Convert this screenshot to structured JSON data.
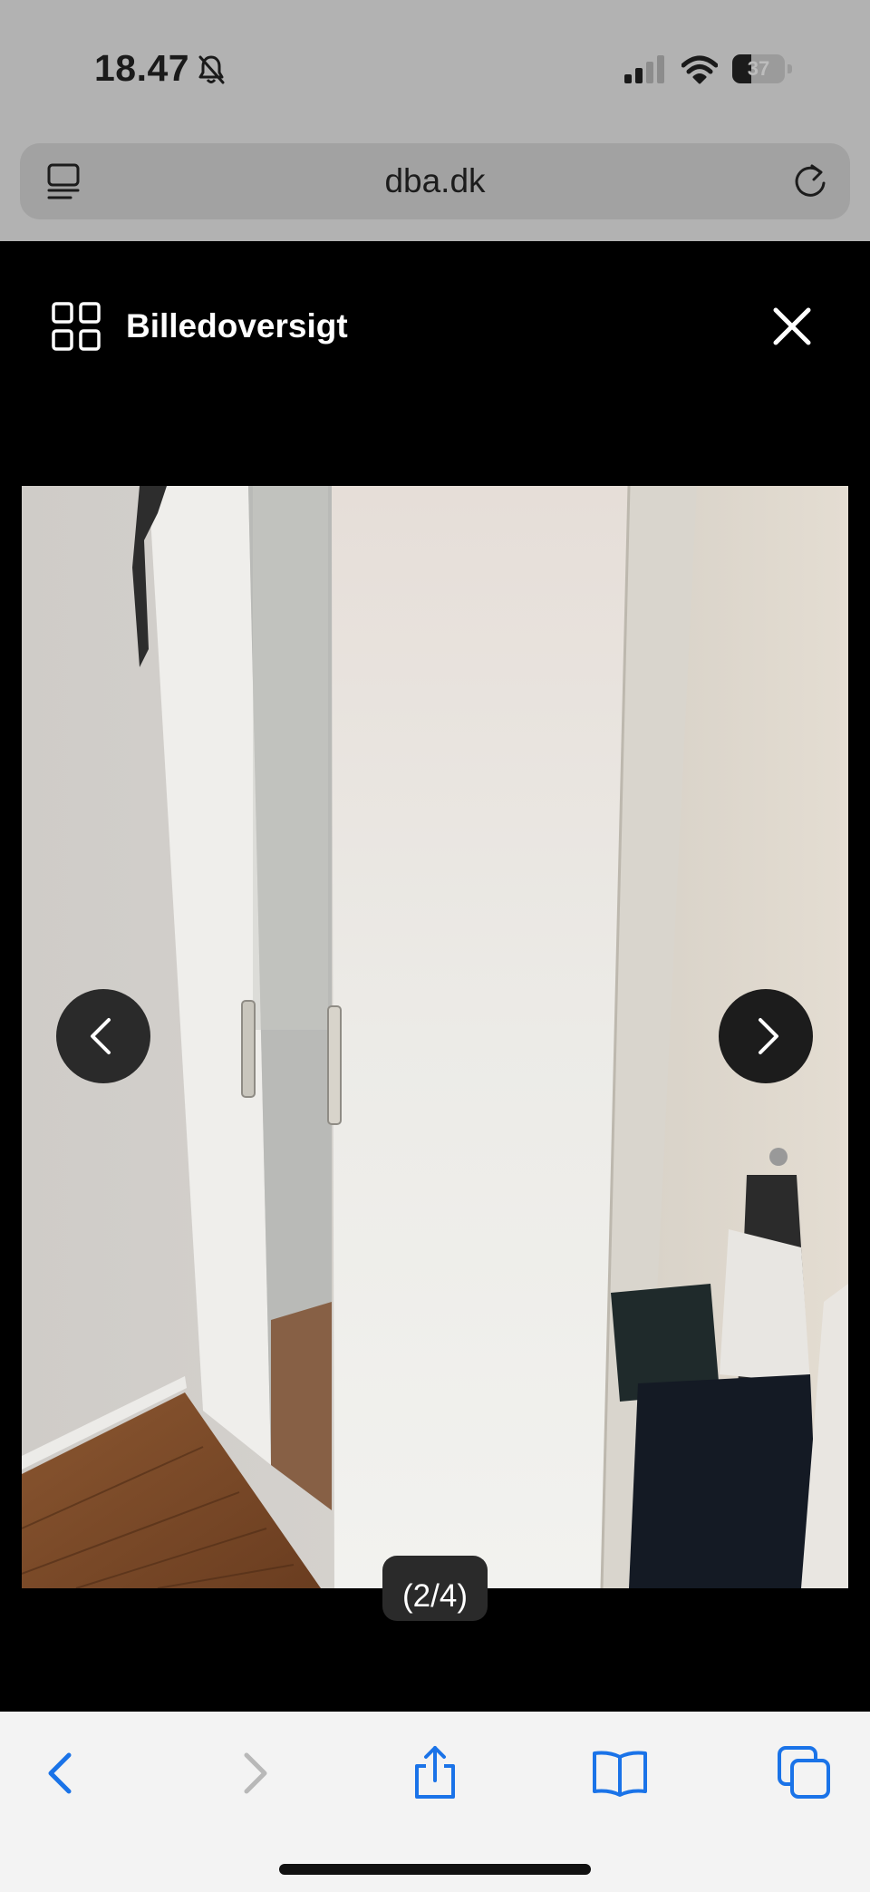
{
  "status_bar": {
    "time": "18.47",
    "battery_percent": "37",
    "battery_level": 0.37,
    "icons": [
      "bell-slash-icon",
      "cellular-signal-icon",
      "wifi-icon",
      "battery-icon"
    ]
  },
  "browser": {
    "url": "dba.dk",
    "icons": [
      "reader-icon",
      "reload-icon"
    ]
  },
  "gallery": {
    "title": "Billedoversigt",
    "counter": "(2/4)",
    "icons": [
      "grid-icon",
      "close-icon",
      "chevron-left-icon",
      "chevron-right-icon"
    ]
  },
  "toolbar": {
    "icons": [
      "back-icon",
      "forward-icon",
      "share-icon",
      "bookmarks-icon",
      "tabs-icon"
    ]
  },
  "colors": {
    "accent": "#1a73e8",
    "toolbar_bg": "#f3f3f3",
    "overlay_bg": "#000000"
  }
}
